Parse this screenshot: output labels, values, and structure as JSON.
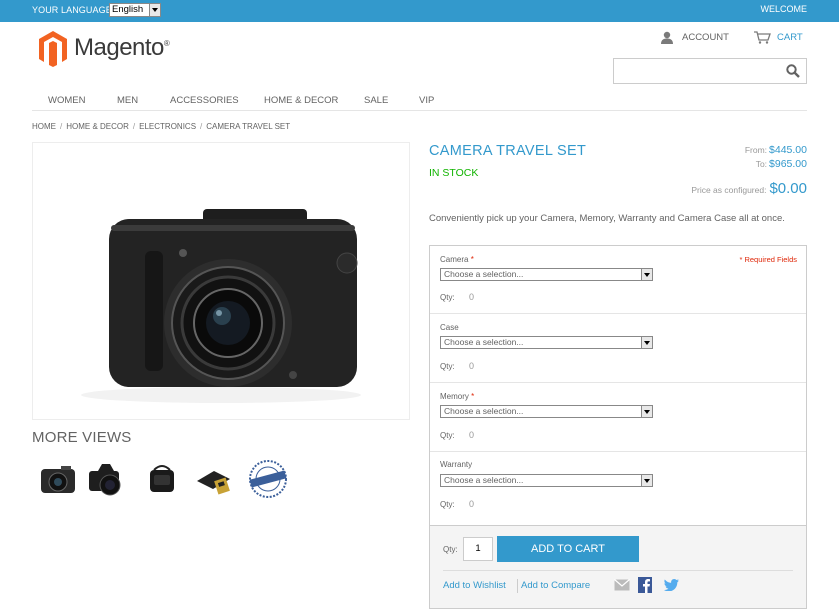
{
  "topbar": {
    "language_label": "YOUR LANGUAGE",
    "language_value": "English",
    "welcome": "WELCOME"
  },
  "header": {
    "logo_text": "Magento",
    "logo_mark": "®",
    "account_label": "ACCOUNT",
    "cart_label": "CART",
    "search_placeholder": ""
  },
  "nav": {
    "items": [
      "WOMEN",
      "MEN",
      "ACCESSORIES",
      "HOME & DECOR",
      "SALE",
      "VIP"
    ]
  },
  "breadcrumb": {
    "items": [
      "HOME",
      "HOME & DECOR",
      "ELECTRONICS",
      "CAMERA TRAVEL SET"
    ],
    "separator": "/"
  },
  "gallery": {
    "more_views_label": "MORE VIEWS"
  },
  "product": {
    "name": "CAMERA TRAVEL SET",
    "availability": "IN STOCK",
    "price_from_label": "From:",
    "price_from": "$445.00",
    "price_to_label": "To:",
    "price_to": "$965.00",
    "price_config_label": "Price as configured:",
    "price_config": "$0.00",
    "short_description": "Conveniently pick up your Camera, Memory, Warranty and Camera Case all at once."
  },
  "options": {
    "required_fields_label": "* Required Fields",
    "required_mark": "*",
    "qty_label": "Qty:",
    "items": [
      {
        "label": "Camera",
        "required": true,
        "select_value": "Choose a selection...",
        "qty": "0"
      },
      {
        "label": "Case",
        "required": false,
        "select_value": "Choose a selection...",
        "qty": "0"
      },
      {
        "label": "Memory",
        "required": true,
        "select_value": "Choose a selection...",
        "qty": "0"
      },
      {
        "label": "Warranty",
        "required": false,
        "select_value": "Choose a selection...",
        "qty": "0"
      }
    ]
  },
  "add_to_cart": {
    "qty_label": "Qty:",
    "qty_value": "1",
    "button_label": "ADD TO CART",
    "wishlist_label": "Add to Wishlist",
    "compare_label": "Add to Compare"
  },
  "colors": {
    "accent": "#3399cc",
    "in_stock": "#11b400",
    "required": "#df280a",
    "logo_orange": "#f26322"
  }
}
